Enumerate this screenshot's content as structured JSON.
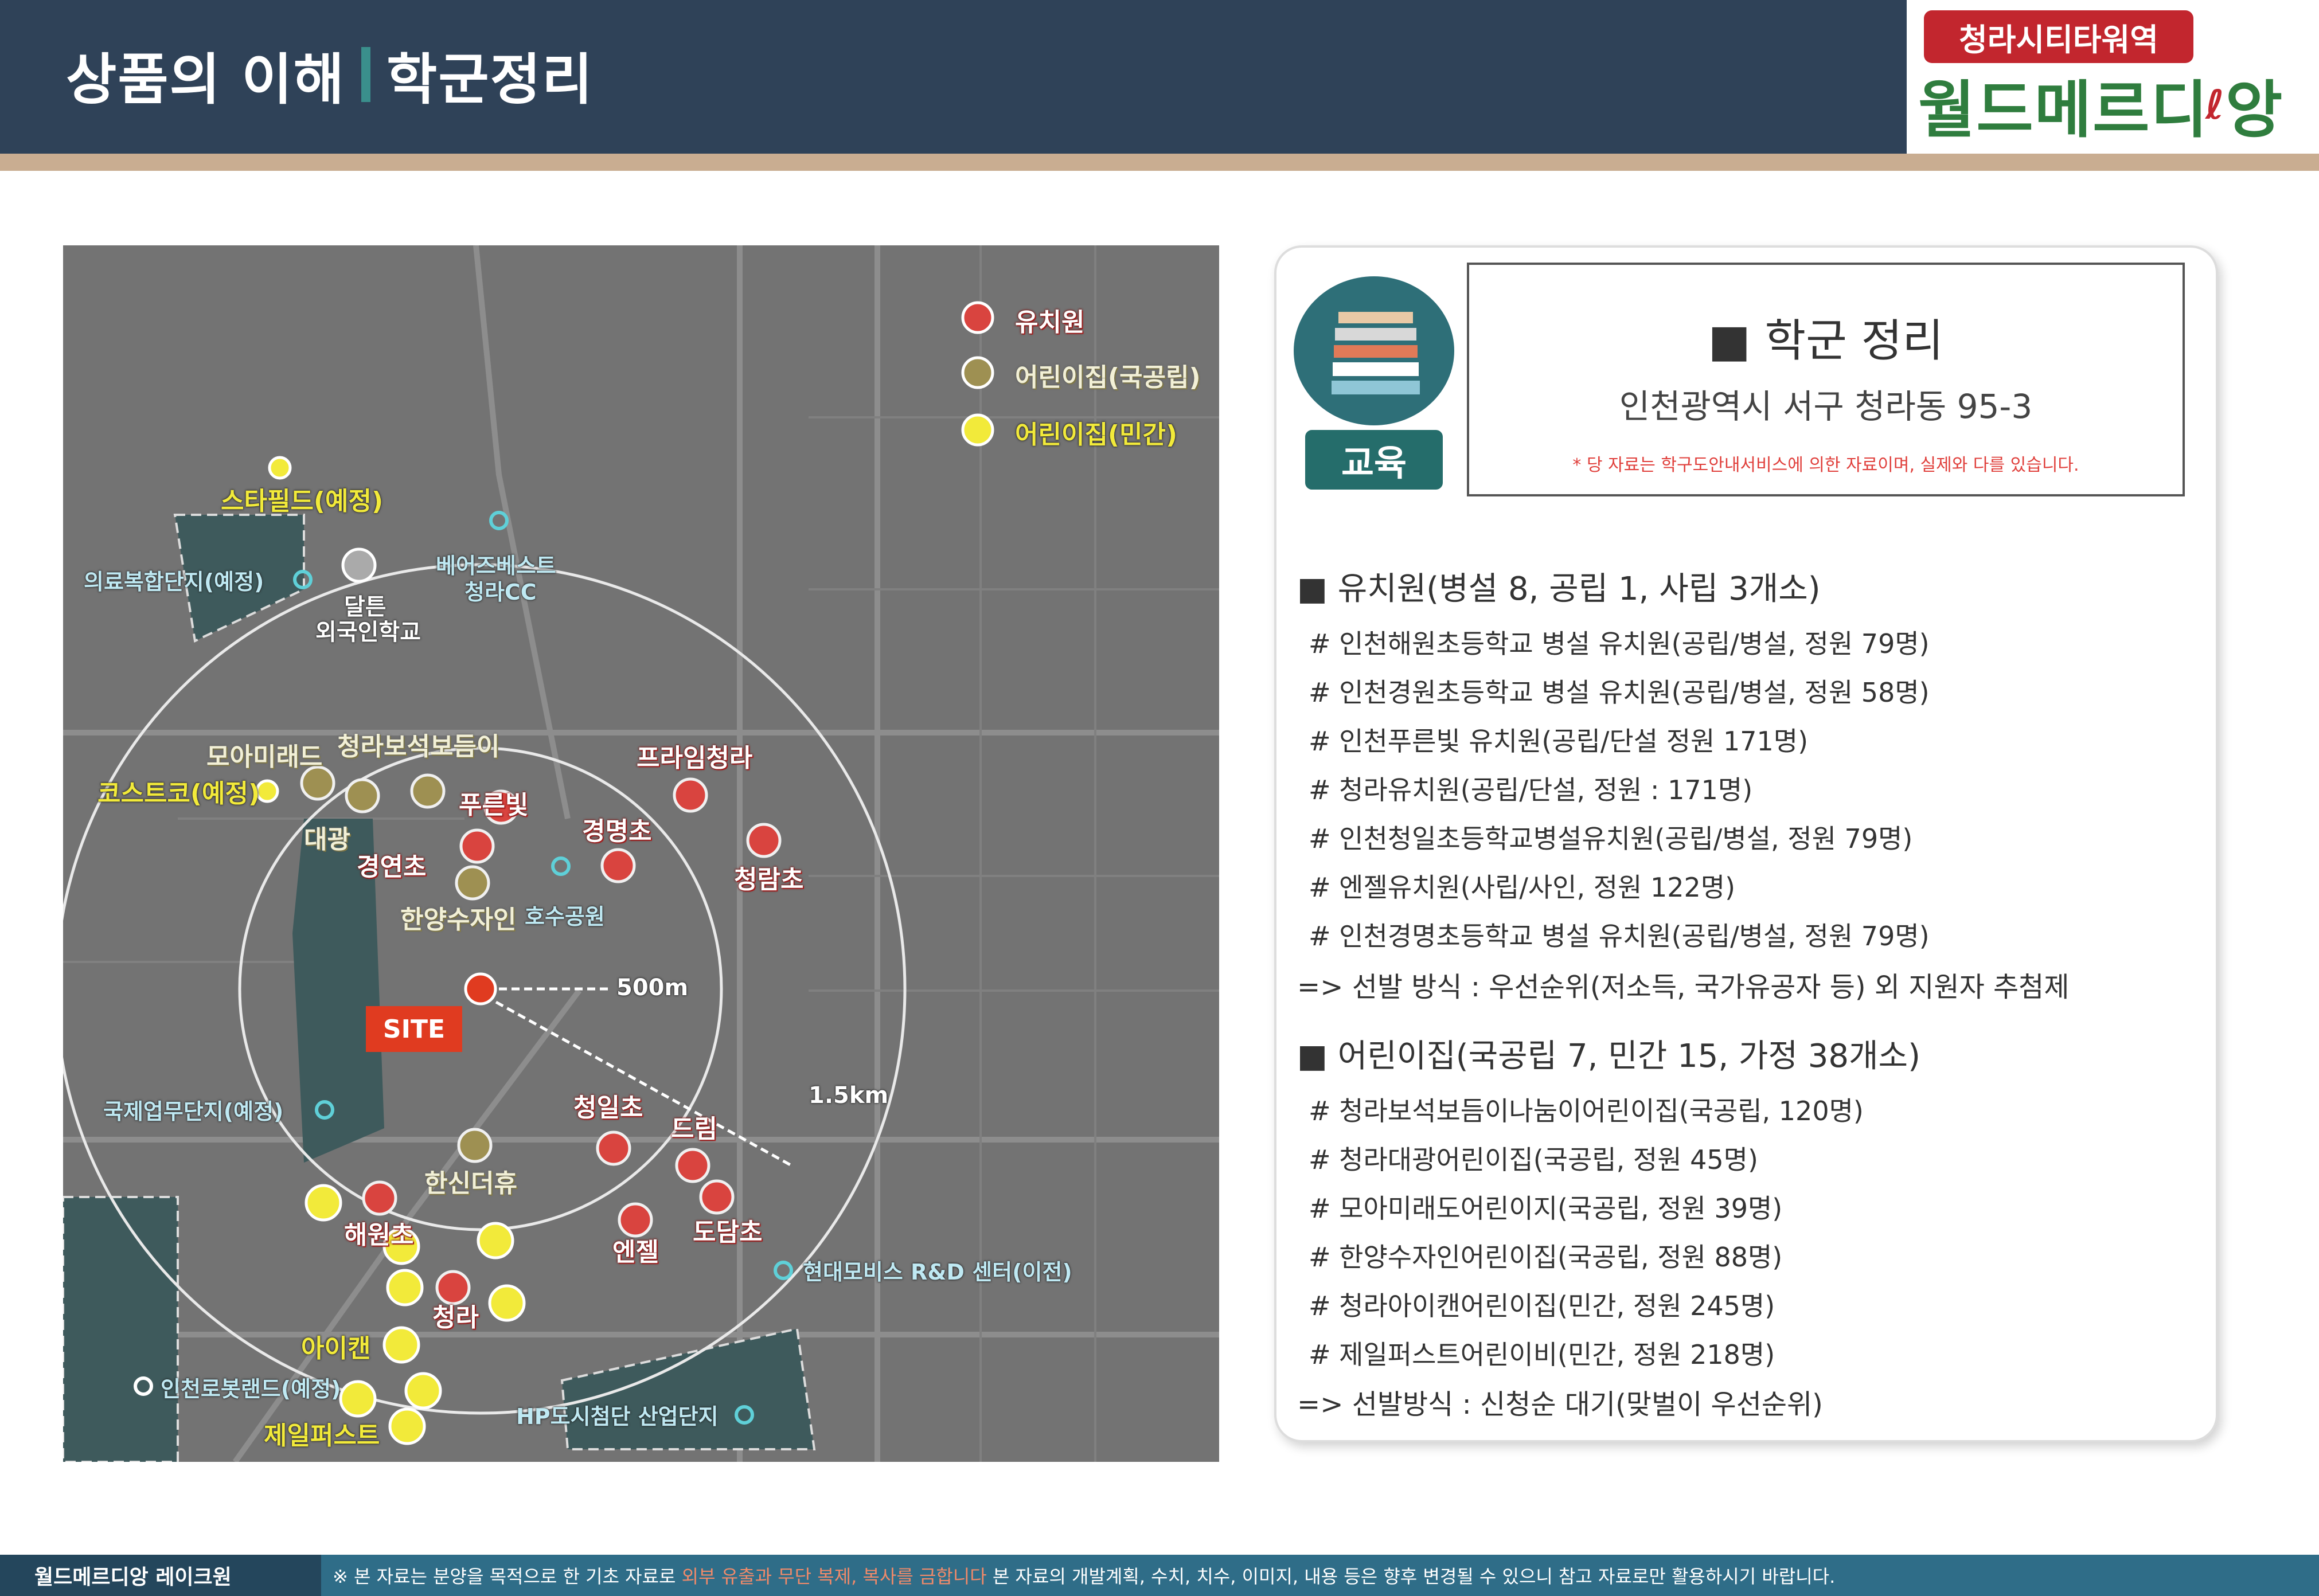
{
  "header": {
    "title_left": "상품의 이해",
    "title_right": "학군정리",
    "brand_badge": "청라시티타워역",
    "brand_name": "월드메르디",
    "brand_name_tail": "앙"
  },
  "map": {
    "legend": [
      {
        "label": "유치원",
        "color": "#d9443f"
      },
      {
        "label": "어린이집(국공립)",
        "color": "#9e9052"
      },
      {
        "label": "어린이집(민간)",
        "color": "#f2ea3a"
      }
    ],
    "site_label": "SITE",
    "radius_small": "500m",
    "radius_large": "1.5km",
    "labels_red": [
      "프라임청라",
      "푸른빛",
      "경명초",
      "경연초",
      "청람초",
      "청일초",
      "드림",
      "도담초",
      "엔젤",
      "해원초",
      "청라"
    ],
    "labels_olive": [
      "모아미래드",
      "청라보석보듬이",
      "대광",
      "한양수자인",
      "한신더휴"
    ],
    "labels_yellow": [
      "스타필드(예정)",
      "코스트코(예정)",
      "아이캔",
      "제일퍼스트"
    ],
    "labels_cyan": [
      "의료복합단지(예정)",
      "베어즈베스트",
      "청라CC",
      "호수공원",
      "국제업무단지(예정)",
      "현대모비스 R&D 센터(이전)",
      "인천로봇랜드(예정)",
      "HP도시첨단 산업단지"
    ],
    "labels_white": [
      "달튼",
      "외국인학교"
    ]
  },
  "card": {
    "edu_tag": "교육",
    "title": "■ 학군 정리",
    "address": "인천광역시 서구 청라동 95-3",
    "note": "* 당 자료는 학구도안내서비스에 의한 자료이며, 실제와 다를 있습니다.",
    "section1": {
      "heading": "■ 유치원(병설 8, 공립 1, 사립 3개소)",
      "items": [
        "# 인천해원초등학교 병설 유치원(공립/병설, 정원 79명)",
        "# 인천경원초등학교 병설 유치원(공립/병설, 정원 58명)",
        "# 인천푸른빛 유치원(공립/단설 정원 171명)",
        "# 청라유치원(공립/단설, 정원 : 171명)",
        "# 인천청일초등학교병설유치원(공립/병설, 정원 79명)",
        "# 엔젤유치원(사립/사인, 정원 122명)",
        "# 인천경명초등학교 병설 유치원(공립/병설, 정원 79명)"
      ],
      "selection": "=> 선발 방식 : 우선순위(저소득, 국가유공자 등) 외 지원자 추첨제"
    },
    "section2": {
      "heading": "■ 어린이집(국공립 7, 민간 15, 가정 38개소)",
      "items": [
        "# 청라보석보듬이나눔이어린이집(국공립, 120명)",
        "# 청라대광어린이집(국공립, 정원 45명)",
        "# 모아미래도어린이지(국공립, 정원 39명)",
        "# 한양수자인어린이집(국공립, 정원 88명)",
        "# 청라아이캔어린이집(민간, 정원 245명)",
        "# 제일퍼스트어린이비(민간, 정원 218명)"
      ],
      "selection": "=> 선발방식 : 신청순 대기(맞벌이 우선순위)"
    }
  },
  "footer": {
    "left": "월드메르디앙 레이크원",
    "text_a": "※ 본 자료는 분양을 목적으로 한 기초 자료로",
    "text_warn": "외부 유출과 무단 복제, 복사를 금합니다",
    "text_b": "본 자료의 개발계획, 수치, 치수, 이미지, 내용 등은 향후 변경될 수 있으니 참고 자료로만 활용하시기 바랍니다."
  }
}
